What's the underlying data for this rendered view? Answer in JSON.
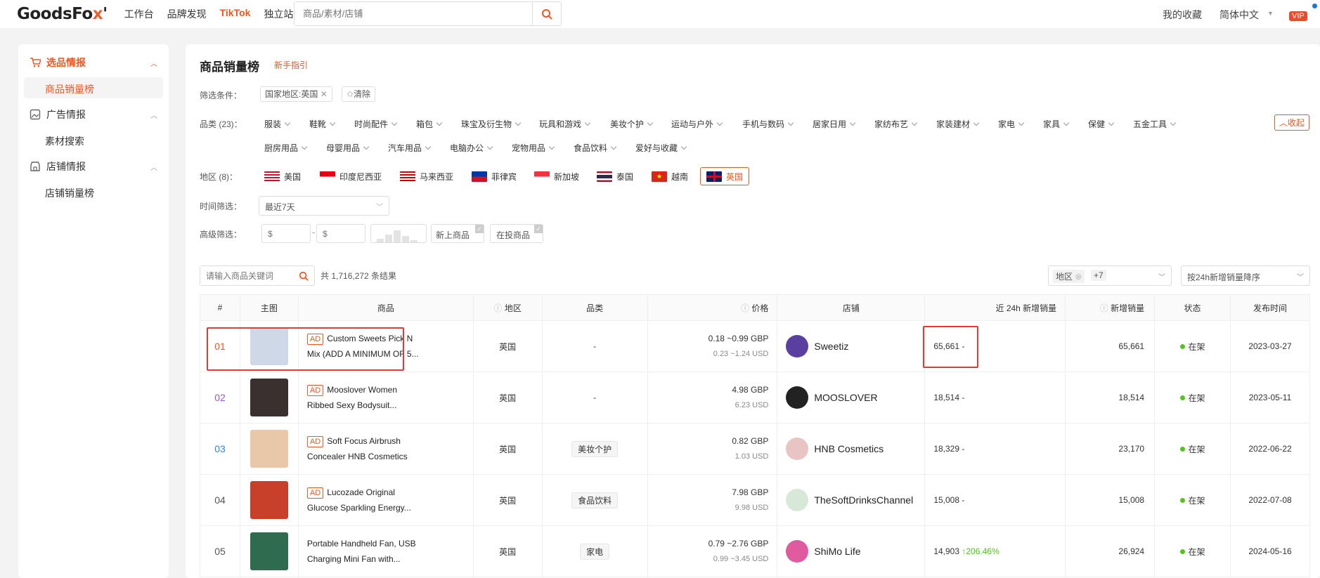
{
  "header": {
    "logo_main": "GoodsFo",
    "logo_x": "x",
    "logo_tail": "'",
    "nav": [
      "工作台",
      "品牌发现",
      "TikTok",
      "独立站"
    ],
    "nav_active": "TikTok",
    "search_placeholder": "商品/素材/店铺",
    "favorites": "我的收藏",
    "language": "简体中文",
    "vip": "VIP"
  },
  "sidebar": {
    "sections": [
      {
        "label": "选品情报",
        "icon": "cart-icon",
        "items": [
          "商品销量榜"
        ]
      },
      {
        "label": "广告情报",
        "icon": "image-icon",
        "items": [
          "素材搜索"
        ]
      },
      {
        "label": "店铺情报",
        "icon": "store-icon",
        "items": [
          "店铺销量榜"
        ]
      }
    ]
  },
  "page": {
    "title": "商品销量榜",
    "guide": "新手指引"
  },
  "filters": {
    "label": "筛选条件：",
    "active_tag": "国家地区:英国",
    "clear": "清除",
    "category_label": "品类 (23)：",
    "categories_row1": [
      "服装",
      "鞋靴",
      "时尚配件",
      "箱包",
      "珠宝及衍生物",
      "玩具和游戏",
      "美妆个护",
      "运动与户外",
      "手机与数码",
      "居家日用",
      "家纺布艺",
      "家装建材",
      "家电",
      "家具",
      "保健",
      "五金工具"
    ],
    "categories_row2": [
      "厨房用品",
      "母婴用品",
      "汽车用品",
      "电脑办公",
      "宠物用品",
      "食品饮料",
      "爱好与收藏"
    ],
    "collapse": "收起",
    "region_label": "地区 (8)：",
    "regions": [
      "美国",
      "印度尼西亚",
      "马来西亚",
      "菲律宾",
      "新加坡",
      "泰国",
      "越南",
      "英国"
    ],
    "region_selected": "英国",
    "time_label": "时间筛选：",
    "time_value": "最近7天",
    "adv_label": "高级筛选：",
    "price_min_placeholder": "$",
    "price_max_placeholder": "$",
    "new_goods": "新上商品",
    "in_ad": "在投商品"
  },
  "results": {
    "keyword_placeholder": "请输入商品关键词",
    "count": "共 1,716,272 条结果",
    "region_filter": "地区",
    "region_more": "+7",
    "sort": "按24h新增销量降序"
  },
  "table": {
    "headers": [
      "#",
      "主图",
      "商品",
      "地区",
      "品类",
      "价格",
      "店铺",
      "近 24h 新增销量",
      "新增销量",
      "状态",
      "发布时间"
    ],
    "rows": [
      {
        "rank": "01",
        "ad": "AD",
        "name1": "Custom Sweets Pick N",
        "name2": "Mix (ADD A MINIMUM OF 5...",
        "region": "英国",
        "category": "-",
        "price_gbp": "0.18 ~0.99 GBP",
        "price_usd": "0.23 ~1.24 USD",
        "shop": "Sweetiz",
        "h24": "65,661 -",
        "growth": "",
        "new_sales": "65,661",
        "status": "在架",
        "date": "2023-03-27",
        "rank_color": "#f5541c",
        "thumb": "#cfd8e6",
        "avatar": "#5a3fa0"
      },
      {
        "rank": "02",
        "ad": "AD",
        "name1": "Mooslover Women",
        "name2": "Ribbed Sexy Bodysuit...",
        "region": "英国",
        "category": "-",
        "price_gbp": "4.98 GBP",
        "price_usd": "6.23 USD",
        "shop": "MOOSLOVER",
        "h24": "18,514 -",
        "growth": "",
        "new_sales": "18,514",
        "status": "在架",
        "date": "2023-05-11",
        "rank_color": "#9b59d0",
        "thumb": "#3a3030",
        "avatar": "#222222"
      },
      {
        "rank": "03",
        "ad": "AD",
        "name1": "Soft Focus Airbrush",
        "name2": "Concealer HNB Cosmetics",
        "region": "英国",
        "category": "美妆个护",
        "price_gbp": "0.82 GBP",
        "price_usd": "1.03 USD",
        "shop": "HNB Cosmetics",
        "h24": "18,329 -",
        "growth": "",
        "new_sales": "23,170",
        "status": "在架",
        "date": "2022-06-22",
        "rank_color": "#2f80ed",
        "thumb": "#e8c8a8",
        "avatar": "#e8c4c4"
      },
      {
        "rank": "04",
        "ad": "AD",
        "name1": "Lucozade Original",
        "name2": "Glucose Sparkling Energy...",
        "region": "英国",
        "category": "食品饮料",
        "price_gbp": "7.98 GBP",
        "price_usd": "9.98 USD",
        "shop": "TheSoftDrinksChannel",
        "h24": "15,008 -",
        "growth": "",
        "new_sales": "15,008",
        "status": "在架",
        "date": "2022-07-08",
        "rank_color": "#555555",
        "thumb": "#c8402a",
        "avatar": "#d8e8d8"
      },
      {
        "rank": "05",
        "ad": "",
        "name1": "Portable Handheld Fan, USB",
        "name2": "Charging Mini Fan with...",
        "region": "英国",
        "category": "家电",
        "price_gbp": "0.79 ~2.76 GBP",
        "price_usd": "0.99 ~3.45 USD",
        "shop": "ShiMo Life",
        "h24": "14,903",
        "growth": "206.46%",
        "new_sales": "26,924",
        "status": "在架",
        "date": "2024-05-16",
        "rank_color": "#555555",
        "thumb": "#2f6b4f",
        "avatar": "#e05aa0"
      }
    ]
  }
}
